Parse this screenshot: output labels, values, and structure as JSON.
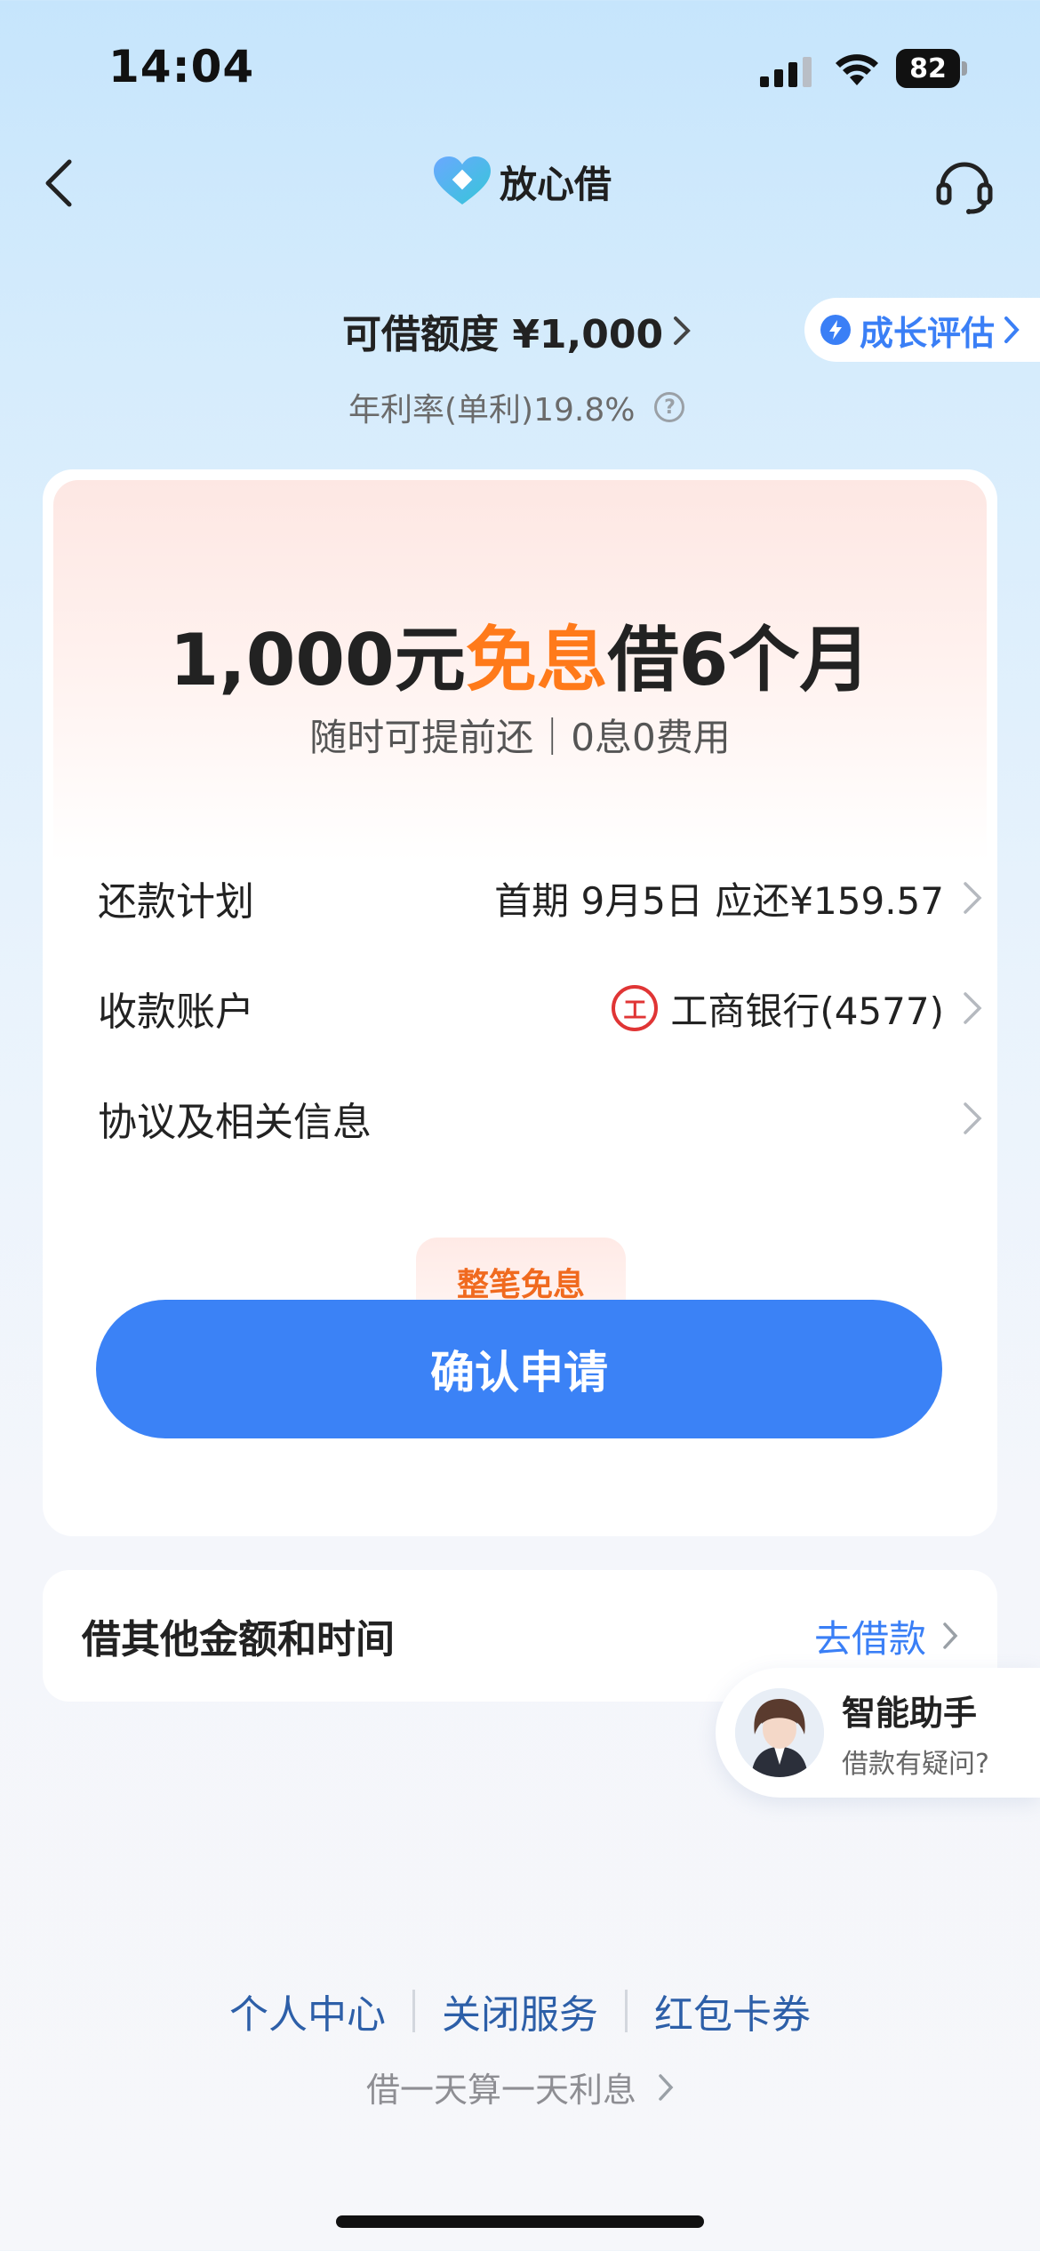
{
  "status_bar": {
    "time": "14:04",
    "battery": "82"
  },
  "nav": {
    "brand": "放心借"
  },
  "limit": {
    "label": "可借额度 ¥1,000",
    "rate": "年利率(单利)19.8%",
    "growth_button": "成长评估"
  },
  "offer": {
    "amount": "1,000元",
    "highlight": "免息",
    "term": "借6个月",
    "subtitle": "随时可提前还｜0息0费用"
  },
  "rows": [
    {
      "label": "还款计划",
      "value": "首期  9月5日  应还¥159.57"
    },
    {
      "label": "收款账户",
      "value": "工商银行(4577)"
    },
    {
      "label": "协议及相关信息",
      "value": ""
    }
  ],
  "bank_icon_text": "工",
  "tag": "整笔免息",
  "confirm_button": "确认申请",
  "other": {
    "label": "借其他金额和时间",
    "action": "去借款"
  },
  "assistant": {
    "name": "智能助手",
    "subtitle": "借款有疑问?"
  },
  "footer": {
    "links": [
      "个人中心",
      "关闭服务",
      "红包卡券"
    ],
    "note": "借一天算一天利息"
  },
  "colors": {
    "accent": "#3b82f6",
    "highlight": "#ff7a1a",
    "link": "#2d5fa8"
  }
}
